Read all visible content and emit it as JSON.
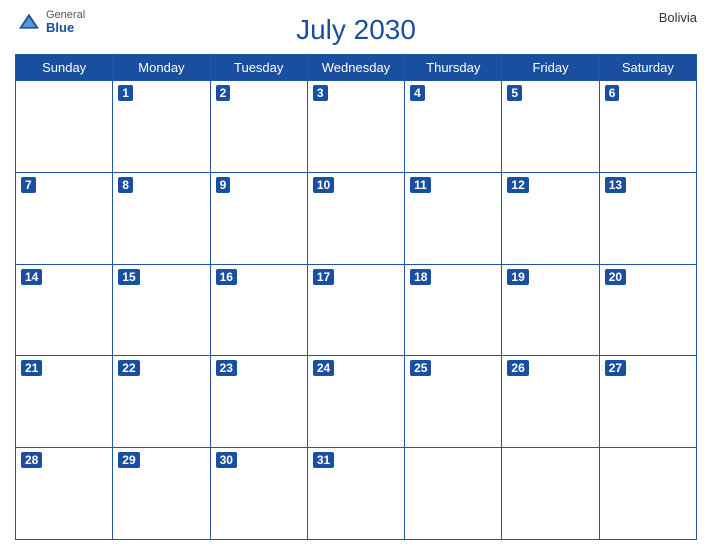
{
  "header": {
    "title": "July 2030",
    "country": "Bolivia",
    "logo": {
      "general": "General",
      "blue": "Blue"
    }
  },
  "days_of_week": [
    "Sunday",
    "Monday",
    "Tuesday",
    "Wednesday",
    "Thursday",
    "Friday",
    "Saturday"
  ],
  "weeks": [
    [
      null,
      1,
      2,
      3,
      4,
      5,
      6
    ],
    [
      7,
      8,
      9,
      10,
      11,
      12,
      13
    ],
    [
      14,
      15,
      16,
      17,
      18,
      19,
      20
    ],
    [
      21,
      22,
      23,
      24,
      25,
      26,
      27
    ],
    [
      28,
      29,
      30,
      31,
      null,
      null,
      null
    ]
  ]
}
